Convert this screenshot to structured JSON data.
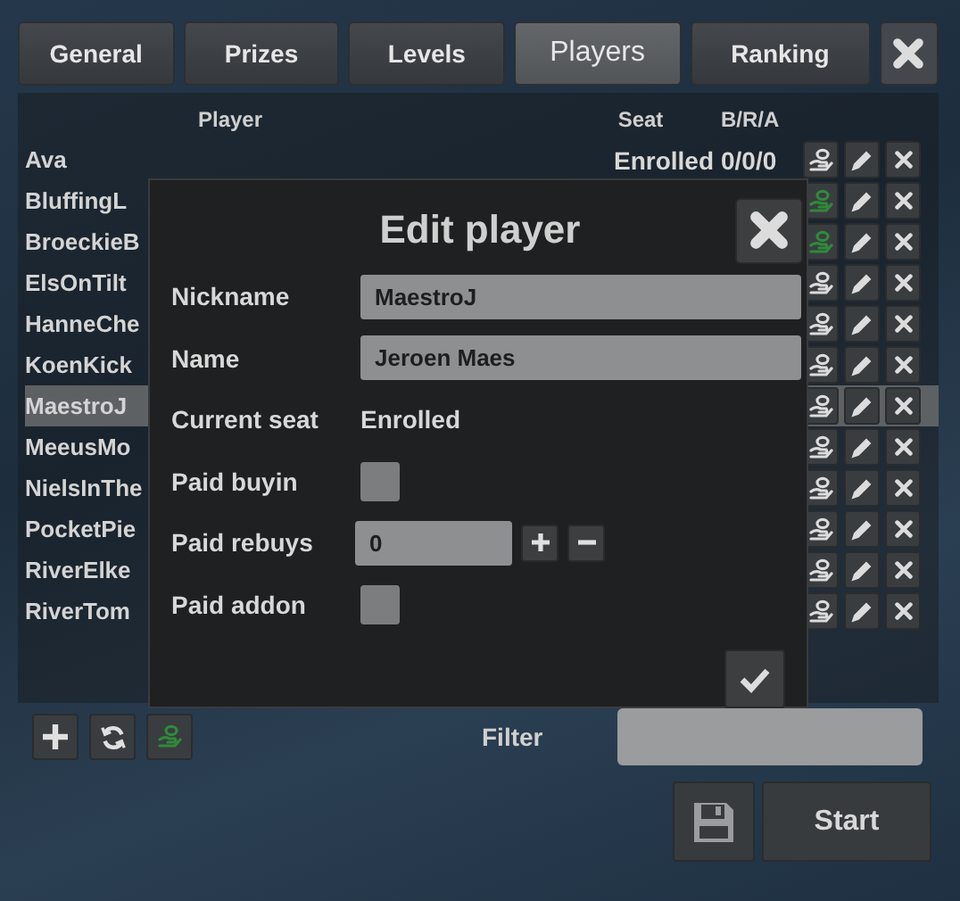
{
  "tabs": [
    {
      "label": "General",
      "selected": false
    },
    {
      "label": "Prizes",
      "selected": false
    },
    {
      "label": "Levels",
      "selected": false
    },
    {
      "label": "Players",
      "selected": true
    },
    {
      "label": "Ranking",
      "selected": false
    }
  ],
  "list": {
    "columns": [
      "Player",
      "Seat",
      "B/R/A"
    ],
    "players": [
      {
        "name": "Ava",
        "seat": "Enrolled",
        "bra": "0/0/0",
        "selected": false,
        "paid": false
      },
      {
        "name": "BluffingL",
        "selected": false,
        "paid": true
      },
      {
        "name": "BroeckieB",
        "selected": false,
        "paid": true
      },
      {
        "name": "ElsOnTilt",
        "selected": false,
        "paid": false
      },
      {
        "name": "HanneChe",
        "selected": false,
        "paid": false
      },
      {
        "name": "KoenKick",
        "selected": false,
        "paid": false
      },
      {
        "name": "MaestroJ",
        "selected": true,
        "paid": false
      },
      {
        "name": "MeeusMo",
        "selected": false,
        "paid": false
      },
      {
        "name": "NielsInThe",
        "selected": false,
        "paid": false
      },
      {
        "name": "PocketPie",
        "selected": false,
        "paid": false
      },
      {
        "name": "RiverElke",
        "selected": false,
        "paid": false
      },
      {
        "name": "RiverTom",
        "selected": false,
        "paid": false
      }
    ]
  },
  "dialog": {
    "title": "Edit player",
    "fields": [
      {
        "kind": "text",
        "label": "Nickname",
        "value": "MaestroJ"
      },
      {
        "kind": "text",
        "label": "Name",
        "value": "Jeroen Maes"
      },
      {
        "kind": "static",
        "label": "Current seat",
        "value": "Enrolled"
      },
      {
        "kind": "checkbox",
        "label": "Paid buyin",
        "checked": false
      },
      {
        "kind": "stepper",
        "label": "Paid rebuys",
        "value": "0"
      },
      {
        "kind": "checkbox",
        "label": "Paid addon",
        "checked": false
      }
    ]
  },
  "toolbar": [
    {
      "kind": "add"
    },
    {
      "kind": "refresh"
    },
    {
      "kind": "paid"
    }
  ],
  "filter": {
    "label": "Filter"
  },
  "start_button": "Start"
}
